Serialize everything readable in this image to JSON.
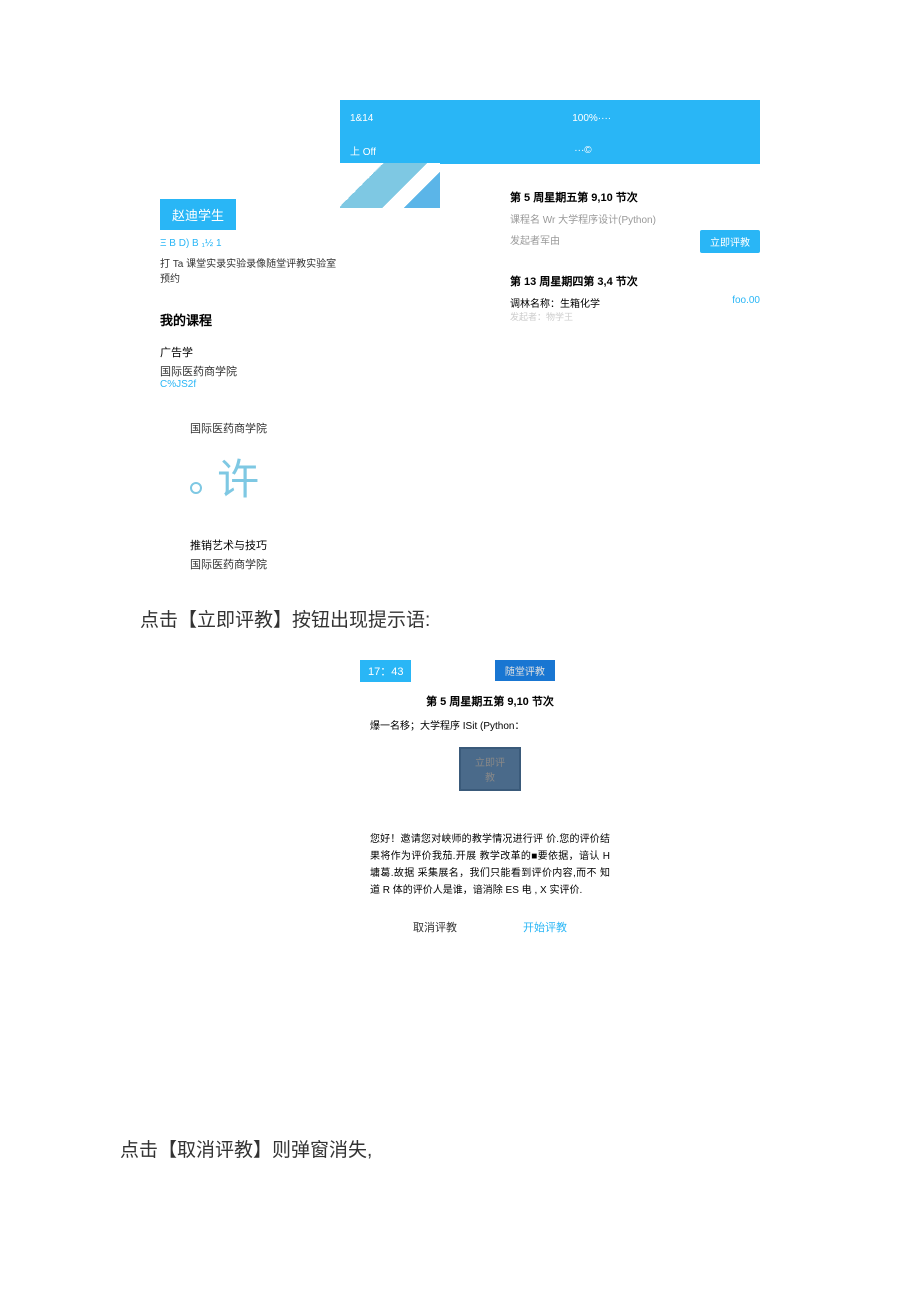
{
  "statusBar": {
    "time": "1&14",
    "battery": "100%····",
    "row2Left": "上 Off",
    "row2Mid": "···©"
  },
  "user": {
    "name": "赵迪学生",
    "links": "Ξ B D) B ₁½ 1",
    "actions": "打 Ta 课堂实录实验录像随堂评教实验室预约"
  },
  "myCourses": {
    "title": "我的课程",
    "item1": {
      "name": "广告学",
      "college": "国际医药商学院",
      "code": "C%JS2f"
    },
    "item2": {
      "college": "国际医药商学院",
      "char": "许"
    },
    "item3": {
      "name": "推销艺术与技巧",
      "college": "国际医药商学院"
    }
  },
  "evals": {
    "card1": {
      "title": "第 5 周星期五第 9,10 节次",
      "line1": "课程名 Wr 大学程序设计(Python)",
      "line2": "发起者军由",
      "btn": "立即评教"
    },
    "card2": {
      "title": "第 13 周星期四第 3,4 节次",
      "line1": "调林名称：生箱化学",
      "line2": "发起者：物学王",
      "foo": "foo.00"
    }
  },
  "instruction1": "点击【立即评教】按钮出现提示语:",
  "modal": {
    "time": "17：43",
    "headerBtn": "随堂评教",
    "title": "第 5 周星期五第 9,10 节次",
    "sub": "爆一名移；大学程序 ISit (Python：",
    "darkBtn": "立即评教",
    "body": "您好！邀请您对峡师的教学情况进行评 价.您的评价结果将作为评价我茄.开展 教学改革的■要依据，谙认 H 墉葛.故据 采集展名，我们只能看到评价内容,而不 知道 R 体的评价人是谁，谙消除 ES 电 , X 实评价.",
    "cancel": "取消评教",
    "start": "开始评教"
  },
  "instruction2": "点击【取消评教】则弹窗消失,"
}
